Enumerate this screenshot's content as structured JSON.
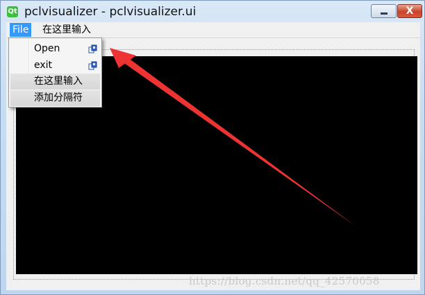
{
  "window": {
    "icon_label": "Qt",
    "title": "pclvisualizer - pclvisualizer.ui",
    "close_glyph": "X"
  },
  "menubar": {
    "items": [
      {
        "label": "File"
      },
      {
        "label": "在这里输入"
      }
    ]
  },
  "file_menu": {
    "items": [
      {
        "label": "Open",
        "icon": "action-icon"
      },
      {
        "label": "exit",
        "icon": "action-icon"
      },
      {
        "label": "在这里输入"
      },
      {
        "label": "添加分隔符"
      }
    ]
  },
  "annotation": {
    "arrow_color": "#ee3333"
  },
  "watermark": "https://blog.csdn.net/qq_42570058"
}
